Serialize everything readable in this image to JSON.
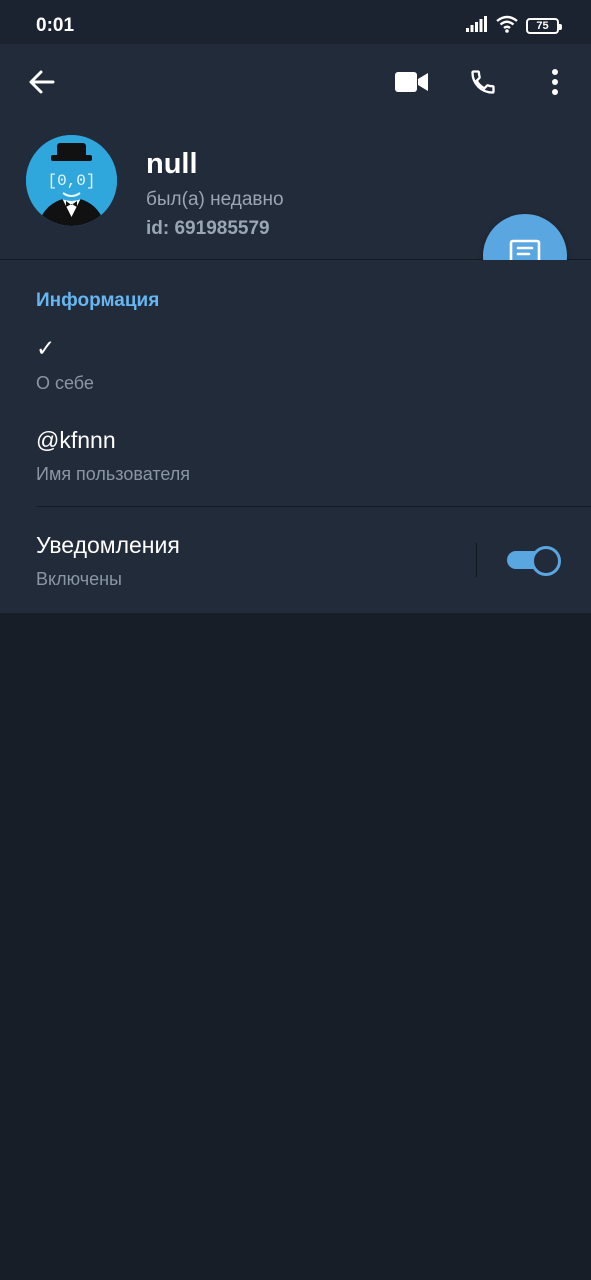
{
  "status_bar": {
    "time": "0:01",
    "battery": "75",
    "icons": [
      "signal-icon",
      "wifi-icon",
      "battery-icon"
    ]
  },
  "toolbar": {
    "icons": [
      "back-arrow-icon",
      "video-call-icon",
      "phone-icon",
      "more-vertical-icon"
    ]
  },
  "profile": {
    "name": "null",
    "status": "был(а) недавно",
    "id": "id: 691985579",
    "avatar_text": "[0,0]"
  },
  "info": {
    "title": "Информация",
    "rows": [
      {
        "value": "✓",
        "label": "О себе"
      },
      {
        "value": "@kfnnn",
        "label": "Имя пользователя"
      }
    ]
  },
  "notifications": {
    "value": "Уведомления",
    "label": "Включены",
    "enabled": true
  },
  "colors": {
    "background": "#181e28",
    "panel": "#222b3a",
    "accent": "#5aa6e0",
    "section_title": "#68b6f1",
    "secondary_text": "#8a96a3"
  }
}
